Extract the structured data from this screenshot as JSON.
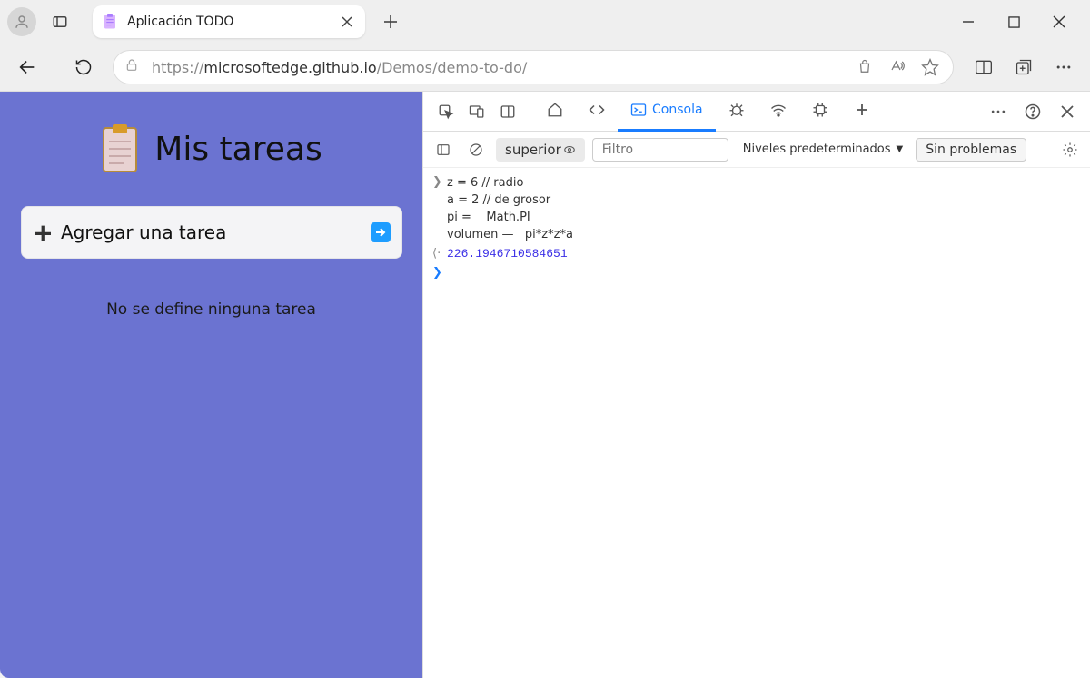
{
  "browser": {
    "tab_title": "Aplicación TODO",
    "url_prefix": "https://",
    "url_host": "microsoftedge.github.io",
    "url_path": "/Demos/demo-to-do/"
  },
  "page": {
    "title": "Mis tareas",
    "add_placeholder": "Agregar una tarea",
    "empty_text": "No se define ninguna tarea"
  },
  "devtools": {
    "tabs": {
      "console": "Consola"
    },
    "console": {
      "context": "superior",
      "filter_placeholder": "Filtro",
      "levels": "Niveles predeterminados",
      "issues": "Sin problemas",
      "code_line1": "z = 6 // radio",
      "code_line2": "a = 2 // de grosor",
      "code_line3": "pi =    Math.PI",
      "code_line4": "volumen —   pi*z*z*a",
      "result": "226.1946710584651"
    }
  }
}
